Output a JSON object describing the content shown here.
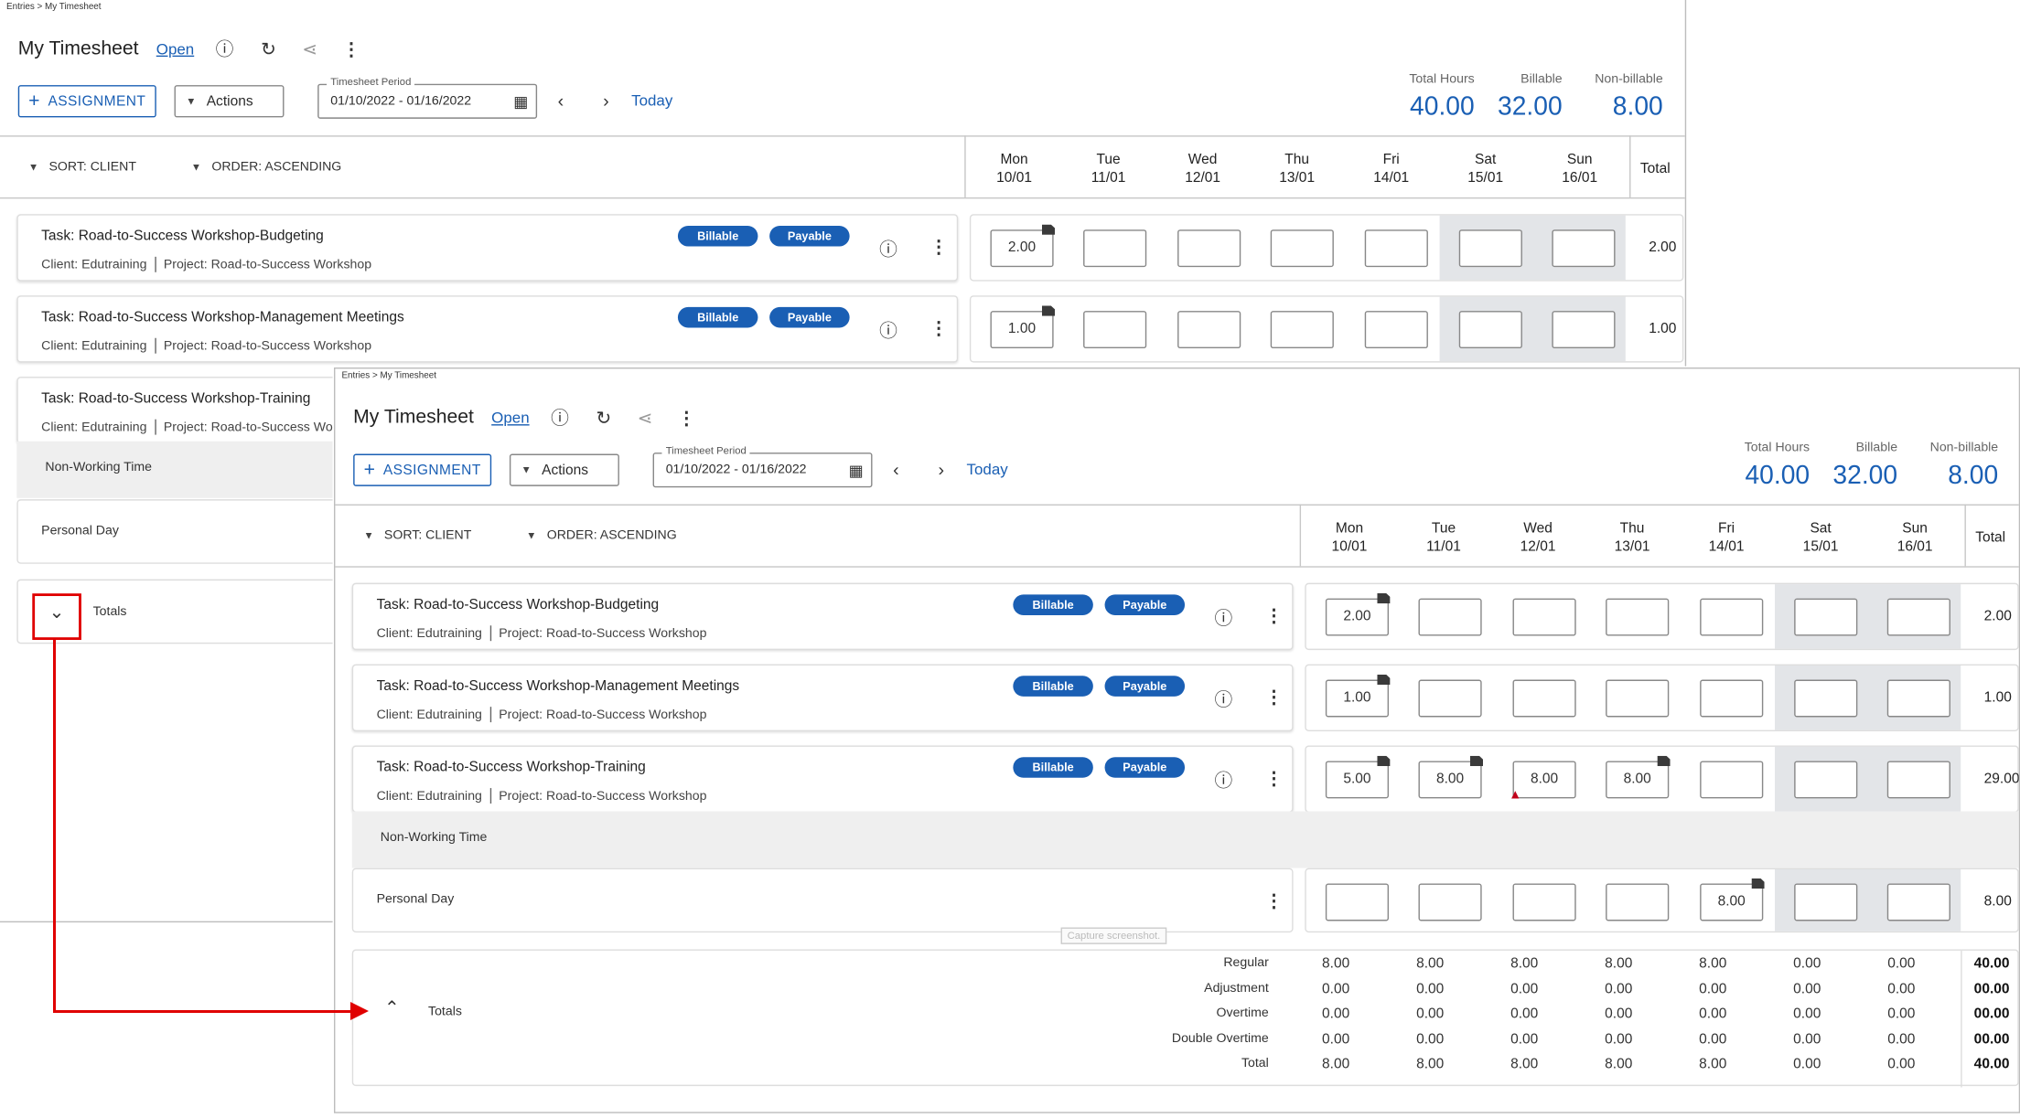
{
  "breadcrumb": "Entries > My Timesheet",
  "page_title": "My Timesheet",
  "status_link": "Open",
  "assignment_button": "ASSIGNMENT",
  "actions_button": "Actions",
  "period": {
    "label": "Timesheet Period",
    "value": "01/10/2022 - 01/16/2022"
  },
  "today_link": "Today",
  "summary": {
    "total_hours_label": "Total Hours",
    "total_hours": "40.00",
    "billable_label": "Billable",
    "billable": "32.00",
    "nonbillable_label": "Non-billable",
    "nonbillable": "8.00"
  },
  "sort": {
    "sort_label": "SORT: CLIENT",
    "order_label": "ORDER: ASCENDING"
  },
  "days": [
    {
      "day": "Mon",
      "date": "10/01"
    },
    {
      "day": "Tue",
      "date": "11/01"
    },
    {
      "day": "Wed",
      "date": "12/01"
    },
    {
      "day": "Thu",
      "date": "13/01"
    },
    {
      "day": "Fri",
      "date": "14/01"
    },
    {
      "day": "Sat",
      "date": "15/01"
    },
    {
      "day": "Sun",
      "date": "16/01"
    }
  ],
  "total_column_label": "Total",
  "tags": {
    "billable": "Billable",
    "payable": "Payable"
  },
  "client_line": "Client: Edutraining",
  "project_line": "Project: Road-to-Success Workshop",
  "rows": [
    {
      "task": "Task: Road-to-Success Workshop-Budgeting",
      "hours": [
        "2.00",
        "",
        "",
        "",
        "",
        "",
        ""
      ],
      "total": "2.00"
    },
    {
      "task": "Task: Road-to-Success Workshop-Management Meetings",
      "hours": [
        "1.00",
        "",
        "",
        "",
        "",
        "",
        ""
      ],
      "total": "1.00"
    },
    {
      "task": "Task: Road-to-Success Workshop-Training",
      "hours": [
        "5.00",
        "8.00",
        "8.00",
        "8.00",
        "",
        "",
        ""
      ],
      "total": "29.00"
    }
  ],
  "non_working_time": "Non-Working Time",
  "personal_day": {
    "label": "Personal Day",
    "hours": [
      "",
      "",
      "",
      "",
      "8.00",
      "",
      ""
    ],
    "total": "8.00"
  },
  "totals": {
    "label": "Totals",
    "rows": [
      {
        "label": "Regular",
        "values": [
          "8.00",
          "8.00",
          "8.00",
          "8.00",
          "8.00",
          "0.00",
          "0.00"
        ],
        "total": "40.00"
      },
      {
        "label": "Adjustment",
        "values": [
          "0.00",
          "0.00",
          "0.00",
          "0.00",
          "0.00",
          "0.00",
          "0.00"
        ],
        "total": "00.00"
      },
      {
        "label": "Overtime",
        "values": [
          "0.00",
          "0.00",
          "0.00",
          "0.00",
          "0.00",
          "0.00",
          "0.00"
        ],
        "total": "00.00"
      },
      {
        "label": "Double Overtime",
        "values": [
          "0.00",
          "0.00",
          "0.00",
          "0.00",
          "0.00",
          "0.00",
          "0.00"
        ],
        "total": "00.00"
      },
      {
        "label": "Total",
        "values": [
          "8.00",
          "8.00",
          "8.00",
          "8.00",
          "8.00",
          "0.00",
          "0.00"
        ],
        "total": "40.00"
      }
    ]
  },
  "capture_label": "Capture screenshot.",
  "colors": {
    "accent": "#1a5fb4",
    "annotation": "#e00000",
    "weekend": "#e3e5e8"
  }
}
